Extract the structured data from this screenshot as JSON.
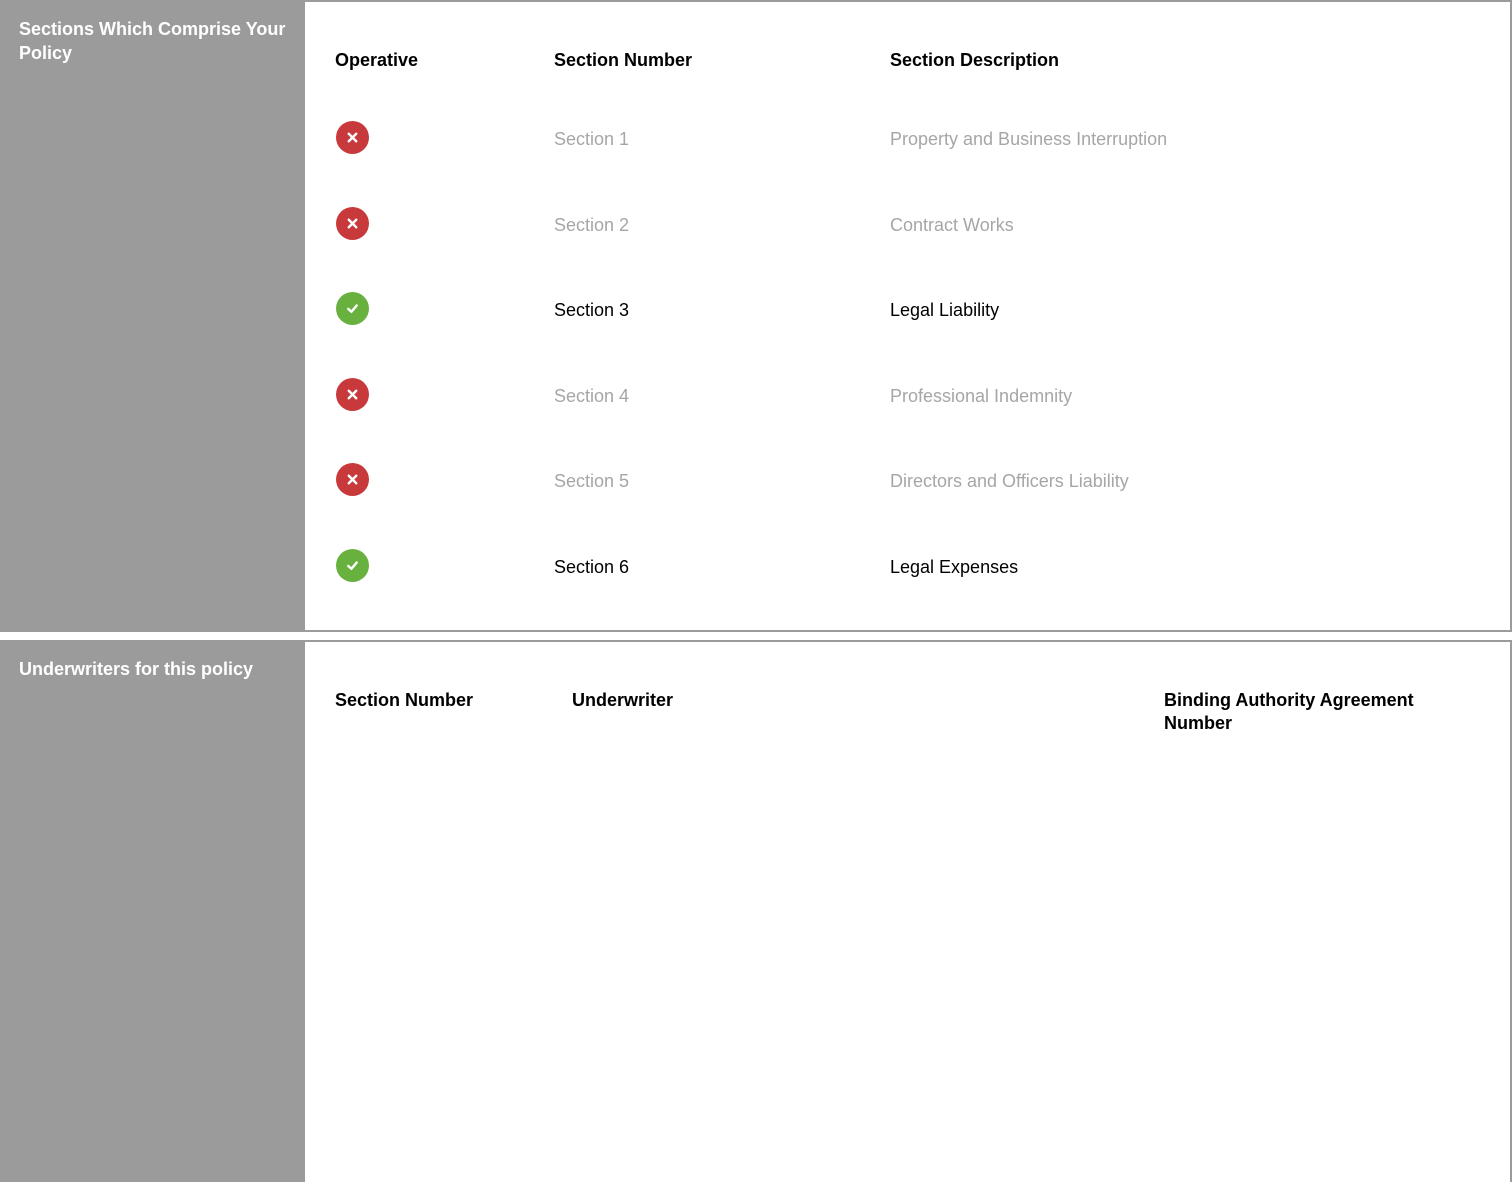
{
  "sections_panel": {
    "title": "Sections Which Comprise Your Policy",
    "headers": {
      "operative": "Operative",
      "section_number": "Section Number",
      "section_description": "Section Description"
    },
    "rows": [
      {
        "operative": false,
        "status_icon": "cross-icon",
        "number": "Section 1",
        "description": "Property and Business Interruption"
      },
      {
        "operative": false,
        "status_icon": "cross-icon",
        "number": "Section 2",
        "description": "Contract Works"
      },
      {
        "operative": true,
        "status_icon": "check-icon",
        "number": "Section 3",
        "description": "Legal Liability"
      },
      {
        "operative": false,
        "status_icon": "cross-icon",
        "number": "Section 4",
        "description": "Professional Indemnity"
      },
      {
        "operative": false,
        "status_icon": "cross-icon",
        "number": "Section 5",
        "description": "Directors and Officers Liability"
      },
      {
        "operative": true,
        "status_icon": "check-icon",
        "number": "Section 6",
        "description": "Legal Expenses"
      }
    ]
  },
  "underwriters_panel": {
    "title": "Underwriters for this policy",
    "headers": {
      "section_number": "Section Number",
      "underwriter": "Underwriter",
      "binding_authority": "Binding Authority Agreement Number"
    },
    "rows": []
  },
  "colors": {
    "sidebar": "#9b9b9b",
    "operative_yes": "#69b13e",
    "operative_no": "#c8393b",
    "inactive_text": "#a6a6a6"
  }
}
